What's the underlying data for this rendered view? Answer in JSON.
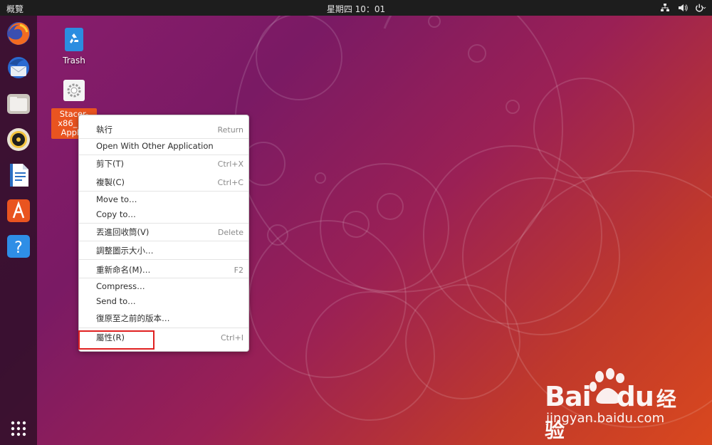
{
  "topbar": {
    "activities": "概覽",
    "clock": "星期四 10：01",
    "tray_icons": [
      "network-icon",
      "volume-icon",
      "power-icon"
    ]
  },
  "dock": {
    "items": [
      {
        "name": "firefox",
        "icon": "firefox-icon"
      },
      {
        "name": "thunderbird",
        "icon": "thunderbird-icon"
      },
      {
        "name": "files",
        "icon": "files-icon"
      },
      {
        "name": "rhythmbox",
        "icon": "rhythmbox-icon"
      },
      {
        "name": "libreoffice-writer",
        "icon": "writer-icon"
      },
      {
        "name": "ubuntu-software",
        "icon": "software-icon"
      },
      {
        "name": "help",
        "icon": "help-icon"
      }
    ],
    "show_apps_icon": "app-grid-icon"
  },
  "desktop": {
    "trash_label": "Trash",
    "selected_file_label": "Stacer-x86_64.AppImage",
    "selected_file_visible": "Stacer-x86_ 64 AppIm"
  },
  "context_menu": {
    "items": [
      {
        "label": "執行",
        "accel": "Return"
      },
      {
        "label": "Open With Other Application",
        "accel": ""
      },
      {
        "label": "剪下(T)",
        "accel": "Ctrl+X"
      },
      {
        "label": "複製(C)",
        "accel": "Ctrl+C"
      },
      {
        "label": "Move to…",
        "accel": ""
      },
      {
        "label": "Copy to…",
        "accel": ""
      },
      {
        "label": "丟進回收筒(V)",
        "accel": "Delete"
      },
      {
        "label": "調整圖示大小…",
        "accel": ""
      },
      {
        "label": "重新命名(M)…",
        "accel": "F2"
      },
      {
        "label": "Compress…",
        "accel": ""
      },
      {
        "label": "Send to…",
        "accel": ""
      },
      {
        "label": "復原至之前的版本…",
        "accel": ""
      },
      {
        "label": "屬性(R)",
        "accel": "Ctrl+I"
      }
    ]
  },
  "watermark": {
    "brand_latin": "Bai",
    "brand_latin_2": "du",
    "brand_cn": "经验",
    "url": "jingyan.baidu.com"
  },
  "colors": {
    "accent": "#e95420",
    "highlight_box": "#e02020"
  }
}
